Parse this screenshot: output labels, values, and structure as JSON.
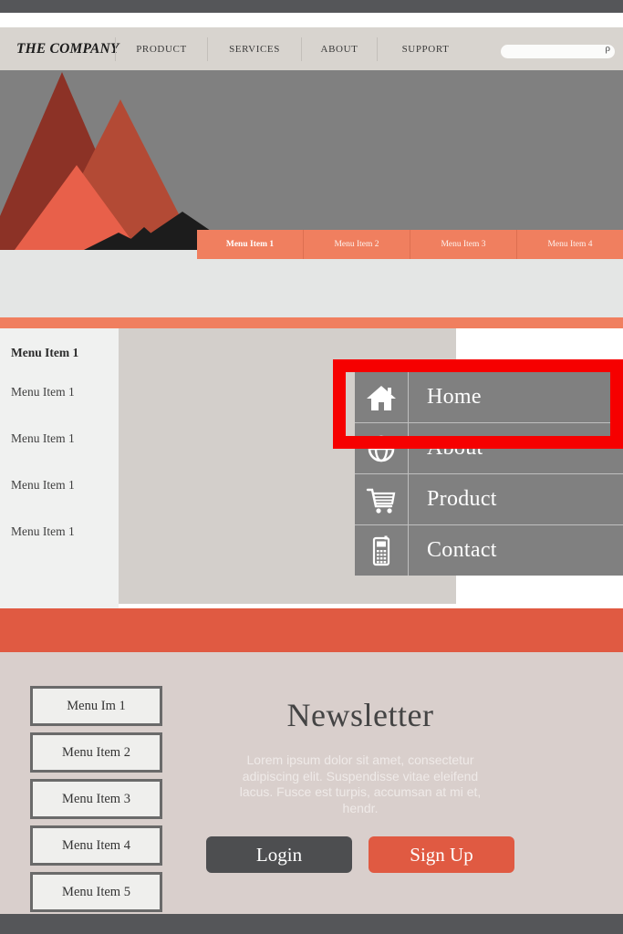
{
  "header": {
    "brand": "THE COMPANY",
    "nav": [
      {
        "label": "PRODUCT"
      },
      {
        "label": "SERVICES"
      },
      {
        "label": "ABOUT"
      },
      {
        "label": "SUPPORT"
      }
    ],
    "search": {
      "value": "",
      "placeholder": "",
      "icon": "search-icon",
      "glyph": "ρ"
    }
  },
  "hero": {
    "background_color": "#808080",
    "mountains": [
      {
        "name": "dark-red-peak",
        "color": "#8C3226"
      },
      {
        "name": "mid-red-peak",
        "color": "#B34A35"
      },
      {
        "name": "salmon-peak",
        "color": "#E8604A"
      },
      {
        "name": "black-peak-right",
        "color": "#1C1C1C"
      },
      {
        "name": "black-peak-front",
        "color": "#1C1C1C"
      }
    ]
  },
  "tabs": [
    {
      "label": "Menu Item 1",
      "active": true
    },
    {
      "label": "Menu Item 2",
      "active": false
    },
    {
      "label": "Menu Item 3",
      "active": false
    },
    {
      "label": "Menu Item 4",
      "active": false
    }
  ],
  "sidebar": {
    "items": [
      {
        "label": "Menu Item 1",
        "bold": true
      },
      {
        "label": "Menu Item 1",
        "bold": false
      },
      {
        "label": "Menu Item 1",
        "bold": false
      },
      {
        "label": "Menu Item 1",
        "bold": false
      },
      {
        "label": "Menu Item 1",
        "bold": false
      }
    ]
  },
  "icon_menu": {
    "items": [
      {
        "label": "Home",
        "icon": "home-icon"
      },
      {
        "label": "About",
        "icon": "globe-icon"
      },
      {
        "label": "Product",
        "icon": "shopping-cart-icon"
      },
      {
        "label": "Contact",
        "icon": "mobile-phone-icon"
      }
    ]
  },
  "highlight": {
    "color": "#F60000",
    "target": "Home"
  },
  "footer_menu": {
    "items": [
      {
        "label": "Menu Im 1"
      },
      {
        "label": "Menu Item 2"
      },
      {
        "label": "Menu Item 3"
      },
      {
        "label": "Menu Item 4"
      },
      {
        "label": "Menu Item 5"
      }
    ]
  },
  "newsletter": {
    "title": "Newsletter",
    "body": "Lorem ipsum dolor sit amet, consectetur adipiscing elit. Suspendisse vitae eleifend lacus. Fusce est turpis, accumsan at mi et, hendr.",
    "login_label": "Login",
    "signup_label": "Sign Up"
  },
  "colors": {
    "accent_orange": "#F07F5F",
    "accent_red": "#E05A42",
    "dark_bar": "#555659",
    "header_bg": "#D8D4CF",
    "panel_bg": "#D3CFCB",
    "footer_bg": "#D9CFCC",
    "highlight_red": "#F60000"
  }
}
